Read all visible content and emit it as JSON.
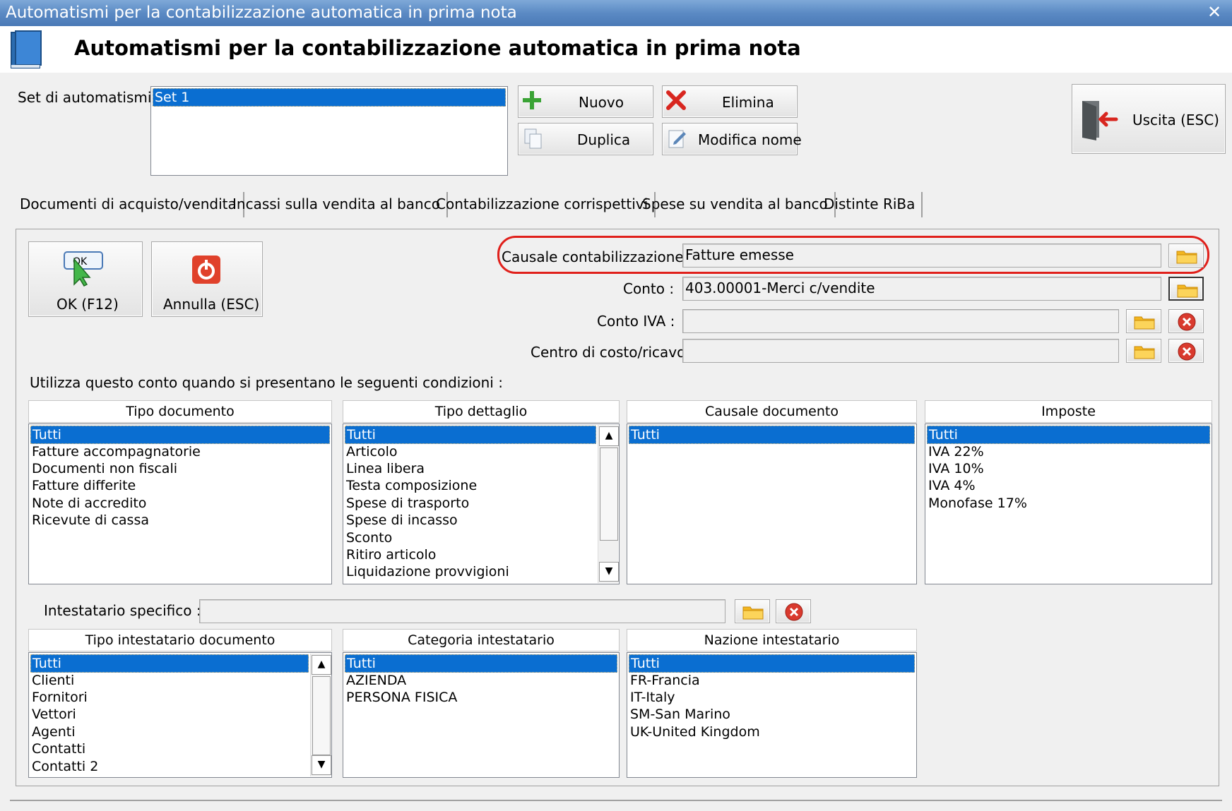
{
  "window": {
    "title": "Automatismi per la contabilizzazione automatica in prima nota",
    "close_glyph": "✕"
  },
  "header": {
    "title": "Automatismi per la contabilizzazione automatica in prima nota",
    "icon": "book-icon"
  },
  "set": {
    "label": "Set di automatismi :",
    "items": [
      "Set 1"
    ]
  },
  "toolbar": {
    "new_label": "Nuovo",
    "delete_label": "Elimina",
    "duplicate_label": "Duplica",
    "rename_label": "Modifica nome",
    "exit_label": "Uscita (ESC)"
  },
  "tabs": [
    {
      "label": "Documenti di acquisto/vendita",
      "active": true
    },
    {
      "label": "Incassi sulla vendita al banco"
    },
    {
      "label": "Contabilizzazione corrispettivi"
    },
    {
      "label": "Spese su vendita al banco"
    },
    {
      "label": "Distinte RiBa"
    }
  ],
  "actions": {
    "ok_label": "OK (F12)",
    "ok_icon_text": "OK",
    "cancel_label": "Annulla (ESC)"
  },
  "form": {
    "causale_label": "Causale contabilizzazione :",
    "causale_value": "Fatture emesse",
    "conto_label": "Conto :",
    "conto_value": "403.00001-Merci c/vendite",
    "conto_iva_label": "Conto IVA :",
    "conto_iva_value": "",
    "centro_label": "Centro di costo/ricavo",
    "centro_value": "",
    "highlight_color": "#e0201b"
  },
  "conditions_label": "Utilizza questo conto quando si presentano le seguenti condizioni :",
  "lists_top": {
    "tipo_documento": {
      "header": "Tipo documento",
      "items": [
        "Tutti",
        "Fatture accompagnatorie",
        "Documenti non fiscali",
        "Fatture differite",
        "Note di accredito",
        "Ricevute di cassa"
      ]
    },
    "tipo_dettaglio": {
      "header": "Tipo dettaglio",
      "items": [
        "Tutti",
        "Articolo",
        "Linea libera",
        "Testa composizione",
        "Spese di trasporto",
        "Spese di incasso",
        "Sconto",
        "Ritiro articolo",
        "Liquidazione provvigioni"
      ]
    },
    "causale_documento": {
      "header": "Causale documento",
      "items": [
        "Tutti"
      ]
    },
    "imposte": {
      "header": "Imposte",
      "items": [
        "Tutti",
        "IVA 22%",
        "IVA 10%",
        "IVA 4%",
        "Monofase 17%"
      ]
    }
  },
  "intestatario": {
    "label": "Intestatario specifico :",
    "value": ""
  },
  "lists_bottom": {
    "tipo_intestatario": {
      "header": "Tipo intestatario documento",
      "items": [
        "Tutti",
        "Clienti",
        "Fornitori",
        "Vettori",
        "Agenti",
        "Contatti",
        "Contatti 2"
      ]
    },
    "categoria": {
      "header": "Categoria intestatario",
      "items": [
        "Tutti",
        "AZIENDA",
        "PERSONA FISICA"
      ]
    },
    "nazione": {
      "header": "Nazione intestatario",
      "items": [
        "Tutti",
        "FR-Francia",
        "IT-Italy",
        "SM-San Marino",
        "UK-United Kingdom"
      ]
    }
  },
  "colors": {
    "selection": "#0a6ed1",
    "titlebar": "#5b8ac4"
  }
}
